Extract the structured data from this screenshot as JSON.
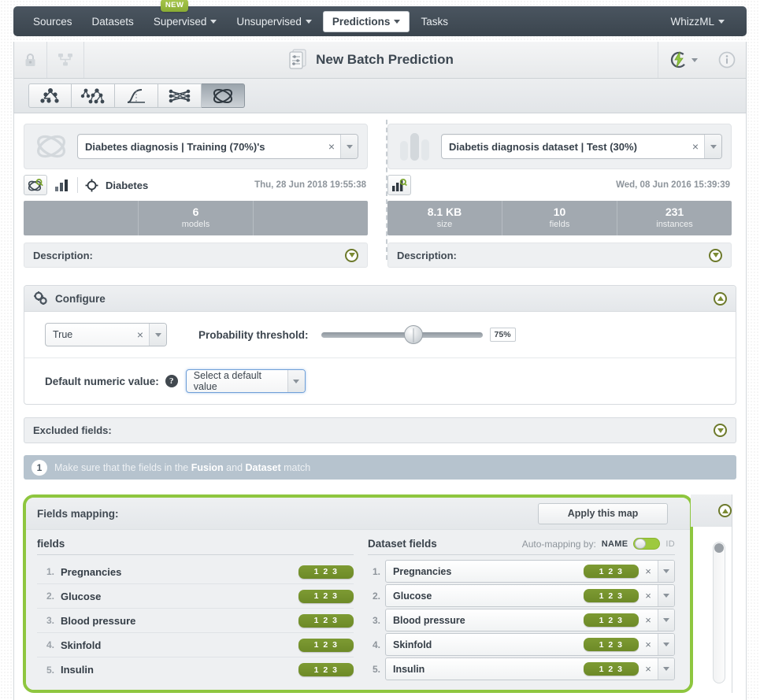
{
  "nav": {
    "items": [
      {
        "label": "Sources",
        "caret": false,
        "active": false
      },
      {
        "label": "Datasets",
        "caret": false,
        "active": false
      },
      {
        "label": "Supervised",
        "caret": true,
        "active": false,
        "badge": "NEW"
      },
      {
        "label": "Unsupervised",
        "caret": true,
        "active": false
      },
      {
        "label": "Predictions",
        "caret": true,
        "active": true
      },
      {
        "label": "Tasks",
        "caret": false,
        "active": false
      }
    ],
    "right": {
      "label": "WhizzML",
      "caret": true
    }
  },
  "header": {
    "title": "New Batch Prediction",
    "lock_icon": "lock-icon",
    "share_icon": "share-network-icon",
    "title_icon": "batch-prediction-icon",
    "action_icon": "lightning-bolt-icon",
    "info_icon": "info-icon"
  },
  "typebar": {
    "buttons": [
      {
        "name": "model-icon",
        "selected": false
      },
      {
        "name": "ensemble-icon",
        "selected": false
      },
      {
        "name": "logistic-regression-icon",
        "selected": false
      },
      {
        "name": "deepnet-icon",
        "selected": false
      },
      {
        "name": "fusion-icon",
        "selected": true
      }
    ]
  },
  "left_panel": {
    "resource_icon": "fusion-icon",
    "selected_value": "Diabetes diagnosis | Training (70%)'s",
    "clear_label": "×",
    "preview_icon": "fusion-search-icon",
    "chart_icon": "bar-chart-icon",
    "objective_icon": "target-icon",
    "objective_name": "Diabetes",
    "date": "Thu, 28 Jun 2018 19:55:38",
    "stats": [
      {
        "value": "",
        "label": ""
      },
      {
        "value": "6",
        "label": "models"
      },
      {
        "value": "",
        "label": ""
      }
    ],
    "description_label": "Description:"
  },
  "right_panel": {
    "resource_icon": "dataset-icon",
    "selected_value": "Diabetis diagnosis dataset | Test (30%)",
    "clear_label": "×",
    "preview_icon": "dataset-search-icon",
    "date": "Wed, 08 Jun 2016 15:39:39",
    "stats": [
      {
        "value": "8.1 KB",
        "label": "size"
      },
      {
        "value": "10",
        "label": "fields"
      },
      {
        "value": "231",
        "label": "instances"
      }
    ],
    "description_label": "Description:"
  },
  "configure": {
    "title": "Configure",
    "gear_icon": "gears-icon",
    "collapse_icon": "chevron-up-circle-icon",
    "class_select": {
      "value": "True",
      "clear_label": "×"
    },
    "threshold_label": "Probability threshold:",
    "threshold_value": "75%",
    "threshold_percent": 75,
    "default_numeric_label": "Default numeric value:",
    "default_numeric_help": "?",
    "default_numeric_select": {
      "value": "Select a default value"
    }
  },
  "excluded_fields": {
    "label": "Excluded fields:",
    "expand_icon": "chevron-down-circle-icon"
  },
  "message": {
    "number": "1",
    "prefix": "Make sure that the fields in the ",
    "bold1": "Fusion",
    "middle": " and ",
    "bold2": "Dataset",
    "suffix": " match"
  },
  "fields_mapping": {
    "title": "Fields mapping:",
    "apply_button": "Apply this map",
    "collapse_icon": "chevron-up-circle-icon",
    "highlight_color": "#8ec63f",
    "left_column": {
      "title": "fields",
      "rows": [
        {
          "num": "1.",
          "name": "Pregnancies",
          "type_badge": "1 2 3"
        },
        {
          "num": "2.",
          "name": "Glucose",
          "type_badge": "1 2 3"
        },
        {
          "num": "3.",
          "name": "Blood pressure",
          "type_badge": "1 2 3"
        },
        {
          "num": "4.",
          "name": "Skinfold",
          "type_badge": "1 2 3"
        },
        {
          "num": "5.",
          "name": "Insulin",
          "type_badge": "1 2 3"
        }
      ]
    },
    "right_column": {
      "title": "Dataset fields",
      "automap_label": "Auto-mapping by:",
      "automap_name": "NAME",
      "automap_id": "ID",
      "automap_on": "NAME",
      "rows": [
        {
          "num": "1.",
          "name": "Pregnancies",
          "type_badge": "1 2 3",
          "clear_label": "×"
        },
        {
          "num": "2.",
          "name": "Glucose",
          "type_badge": "1 2 3",
          "clear_label": "×"
        },
        {
          "num": "3.",
          "name": "Blood pressure",
          "type_badge": "1 2 3",
          "clear_label": "×"
        },
        {
          "num": "4.",
          "name": "Skinfold",
          "type_badge": "1 2 3",
          "clear_label": "×"
        },
        {
          "num": "5.",
          "name": "Insulin",
          "type_badge": "1 2 3",
          "clear_label": "×"
        }
      ]
    }
  }
}
